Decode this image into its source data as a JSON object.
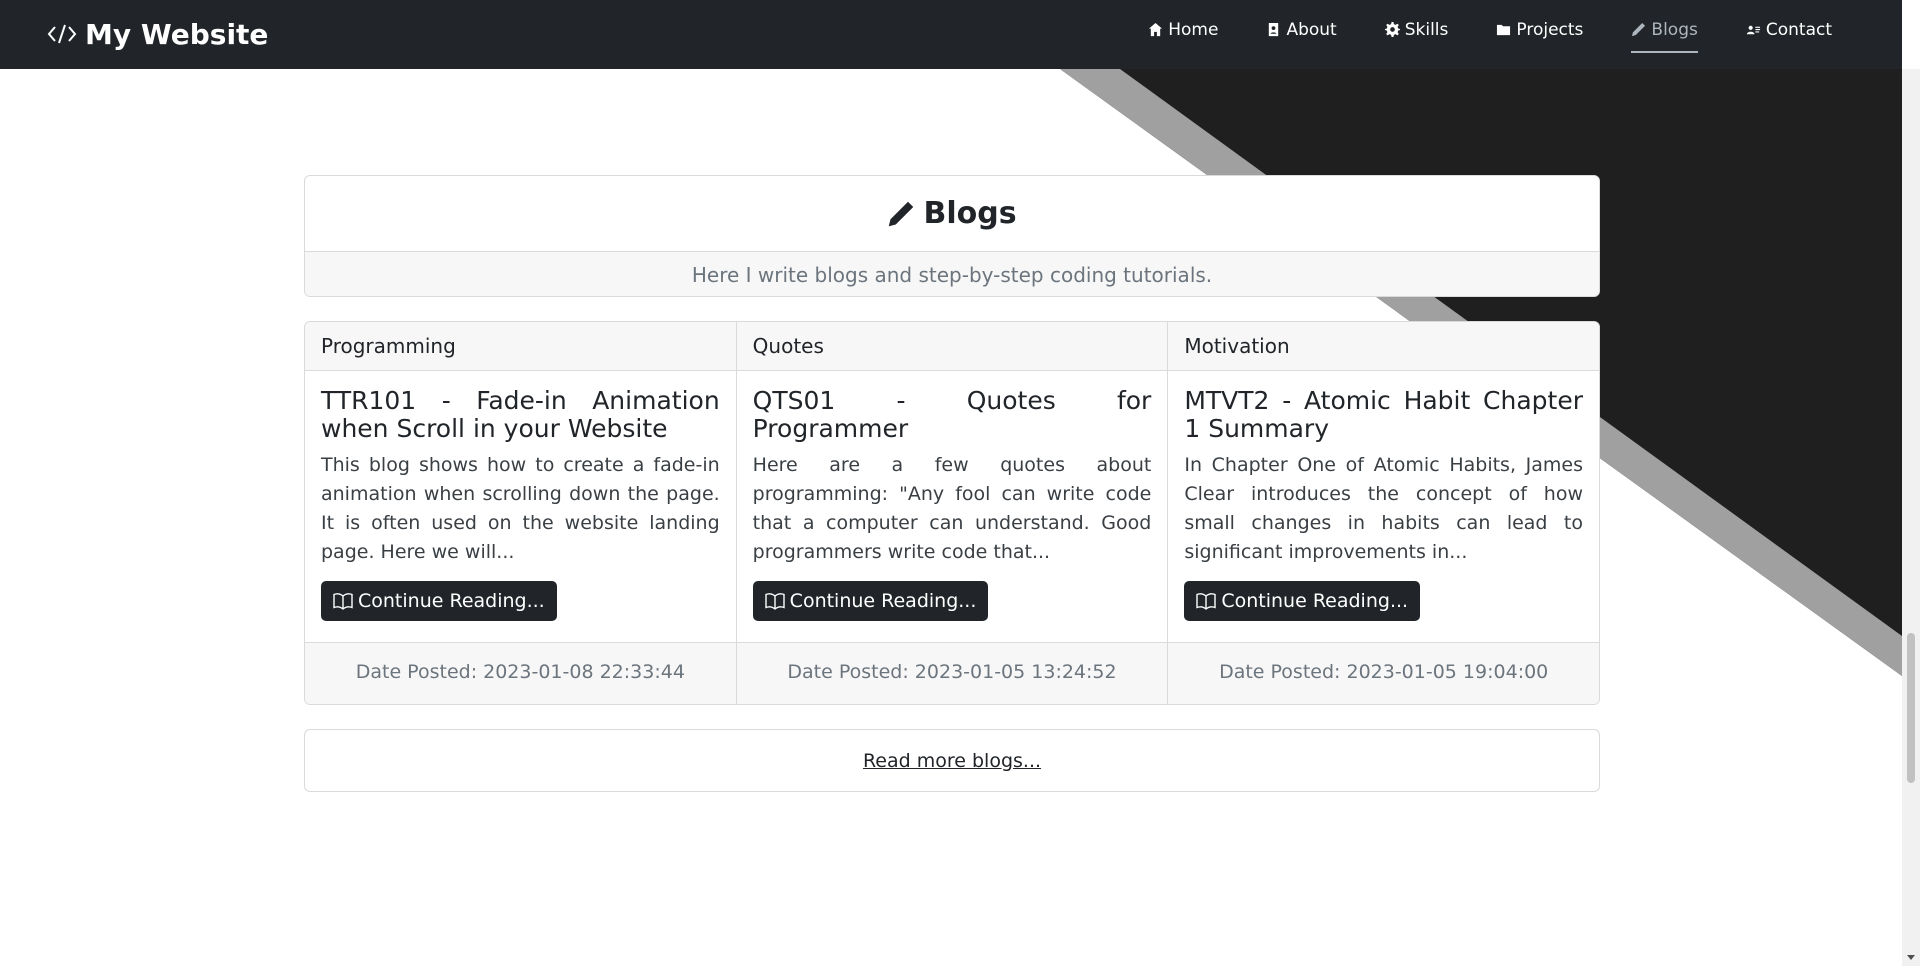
{
  "navbar": {
    "brand": "My Website",
    "links": [
      {
        "label": "Home",
        "icon": "home-icon"
      },
      {
        "label": "About",
        "icon": "id-badge-icon"
      },
      {
        "label": "Skills",
        "icon": "gear-icon"
      },
      {
        "label": "Projects",
        "icon": "folder-icon"
      },
      {
        "label": "Blogs",
        "icon": "pen-icon",
        "active": true
      },
      {
        "label": "Contact",
        "icon": "address-card-icon"
      }
    ]
  },
  "header": {
    "title": "Blogs",
    "subtitle": "Here I write blogs and step-by-step coding tutorials."
  },
  "blogs": [
    {
      "category": "Programming",
      "title": "TTR101 - Fade-in Animation when Scroll in your Website",
      "text": "This blog shows how to create a fade-in animation when scrolling down the page. It is often used on the website landing page. Here we will...",
      "button": "Continue Reading...",
      "date": "Date Posted: 2023-01-08 22:33:44"
    },
    {
      "category": "Quotes",
      "title": "QTS01 - Quotes for Programmer",
      "text": "Here are a few quotes about programming: \"Any fool can write code that a computer can understand. Good programmers write code that...",
      "button": "Continue Reading...",
      "date": "Date Posted: 2023-01-05 13:24:52"
    },
    {
      "category": "Motivation",
      "title": "MTVT2 - Atomic Habit Chapter 1 Summary",
      "text": "In Chapter One of Atomic Habits, James Clear introduces the concept of how small changes in habits can lead to significant improvements in...",
      "button": "Continue Reading...",
      "date": "Date Posted: 2023-01-05 19:04:00"
    }
  ],
  "more_link": "Read more blogs...",
  "colors": {
    "navbar_bg": "#212529",
    "accent_dark": "#212529",
    "stripe_gray": "#a0a0a0",
    "muted_text": "#6c757d"
  }
}
